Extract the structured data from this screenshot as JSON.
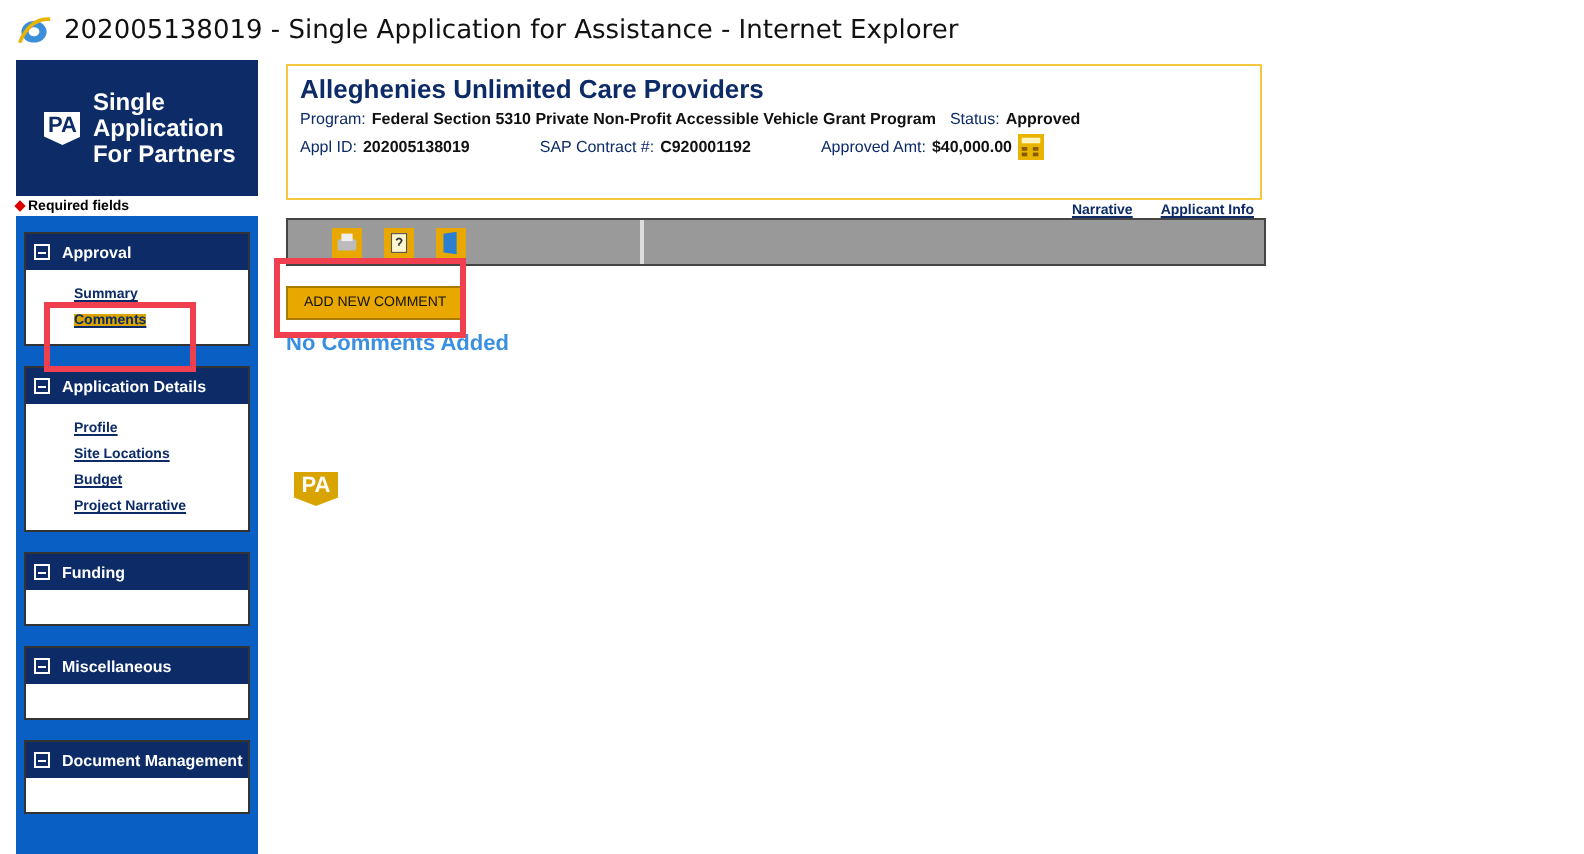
{
  "window": {
    "title": "202005138019 - Single Application for Assistance - Internet Explorer"
  },
  "brand": {
    "logo_text": "PA",
    "title": "Single Application For Partners"
  },
  "required_note": "Required fields",
  "sidebar": {
    "sections": [
      {
        "title": "Approval",
        "items": [
          {
            "label": "Summary",
            "selected": false
          },
          {
            "label": "Comments",
            "selected": true
          }
        ]
      },
      {
        "title": "Application Details",
        "items": [
          {
            "label": "Profile",
            "selected": false
          },
          {
            "label": "Site Locations",
            "selected": false
          },
          {
            "label": "Budget",
            "selected": false
          },
          {
            "label": "Project Narrative",
            "selected": false
          }
        ]
      },
      {
        "title": "Funding"
      },
      {
        "title": "Miscellaneous"
      },
      {
        "title": "Document Management"
      }
    ]
  },
  "applicant": {
    "name": "Alleghenies Unlimited Care Providers",
    "program_label": "Program:",
    "program": "Federal Section 5310 Private Non-Profit Accessible Vehicle Grant Program",
    "status_label": "Status:",
    "status": "Approved",
    "appl_id_label": "Appl ID:",
    "appl_id": "202005138019",
    "sap_label": "SAP Contract #:",
    "sap": "C920001192",
    "amount_label": "Approved Amt:",
    "amount": "$40,000.00"
  },
  "links": [
    "Narrative",
    "Applicant Info"
  ],
  "add_button": "ADD NEW COMMENT",
  "empty_message": "No Comments Added",
  "footer_logo_text": "PA"
}
